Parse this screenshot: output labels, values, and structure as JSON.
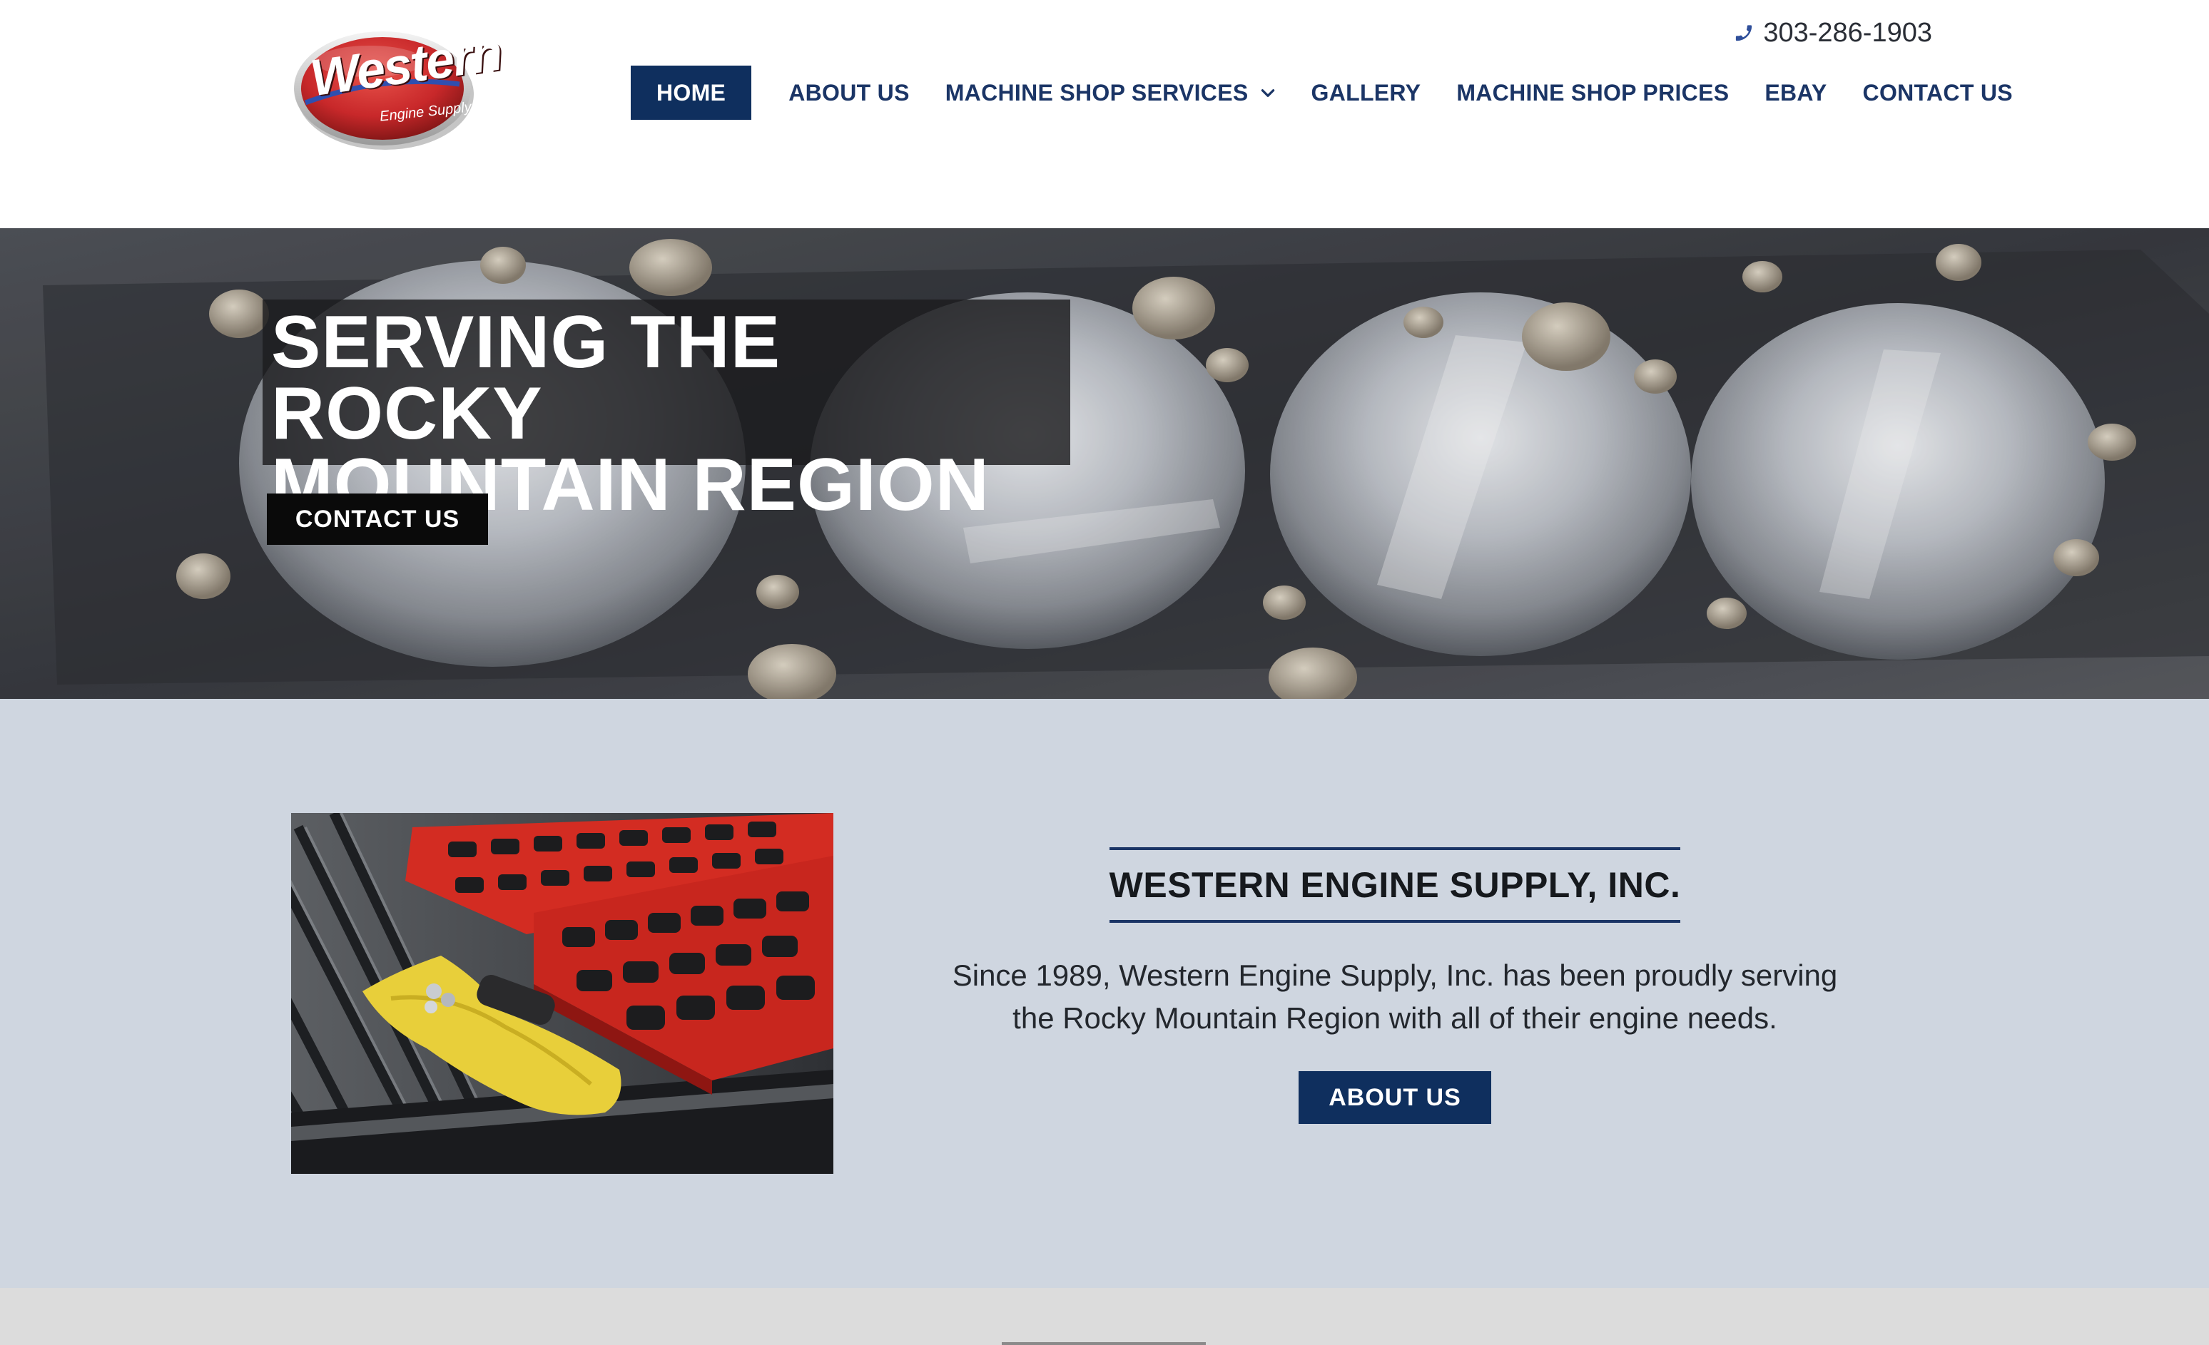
{
  "header": {
    "logo_alt": "Western Engine Supply",
    "logo_text": "Western",
    "logo_subtext": "Engine Supply",
    "phone": "303-286-1903",
    "phone_icon": "phone-icon"
  },
  "nav": {
    "items": [
      {
        "label": "HOME",
        "active": true
      },
      {
        "label": "ABOUT US",
        "active": false
      },
      {
        "label": "MACHINE SHOP SERVICES",
        "active": false,
        "has_dropdown": true
      },
      {
        "label": "GALLERY",
        "active": false
      },
      {
        "label": "MACHINE SHOP PRICES",
        "active": false
      },
      {
        "label": "EBAY",
        "active": false
      },
      {
        "label": "CONTACT US",
        "active": false
      }
    ]
  },
  "hero": {
    "title_line1": "SERVING THE ROCKY",
    "title_line2": "MOUNTAIN REGION",
    "button_label": "CONTACT US"
  },
  "about": {
    "heading": "WESTERN ENGINE SUPPLY, INC.",
    "text_line1": "Since 1989, Western Engine Supply, Inc. has been proudly serving",
    "text_line2": "the Rocky Mountain Region with all of their engine needs.",
    "button_label": "ABOUT US"
  },
  "colors": {
    "brand_navy": "#0f2f5e",
    "nav_text": "#1b3566",
    "section_bg": "#cfd6e0",
    "logo_red": "#c8282a"
  }
}
